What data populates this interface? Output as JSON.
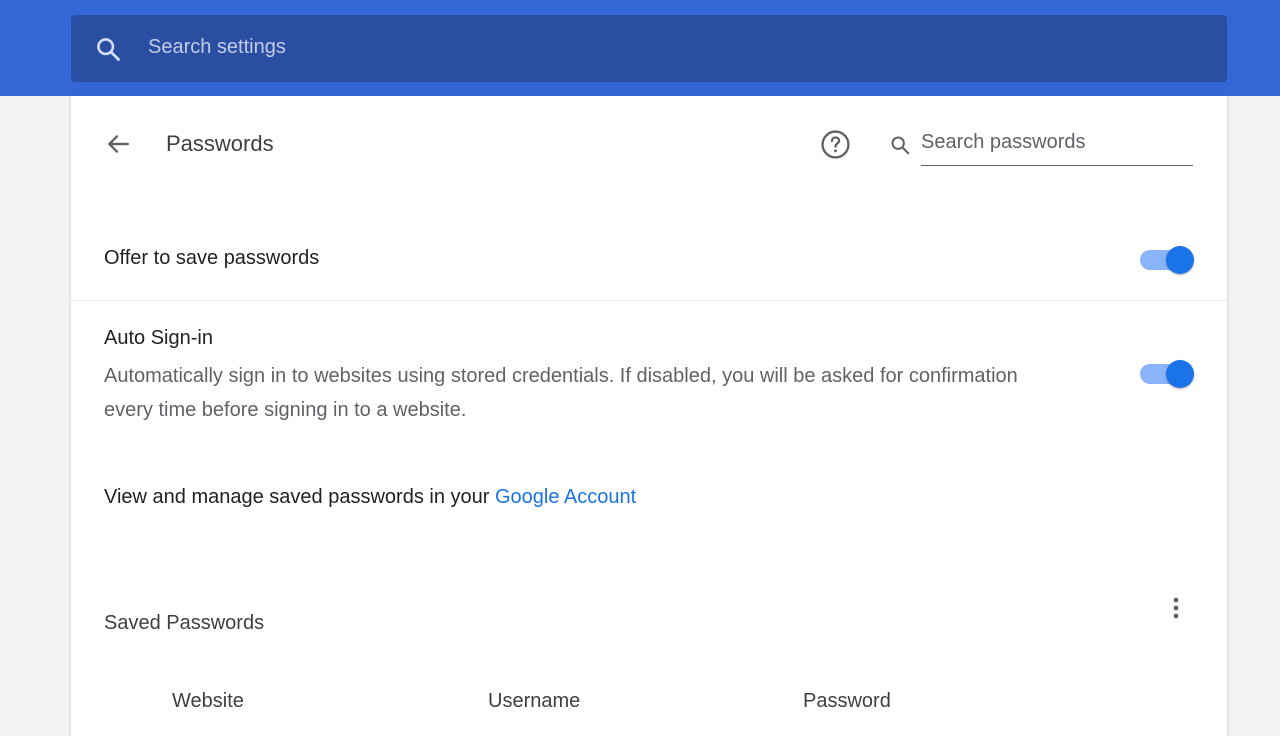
{
  "header": {
    "search_placeholder": "Search settings",
    "search_icon": "search-icon"
  },
  "passwords_page": {
    "title": "Passwords",
    "back_icon": "arrow-left-icon",
    "help_icon": "help-circle-icon",
    "search_placeholder": "Search passwords",
    "search_value": ""
  },
  "settings": {
    "offer_to_save": {
      "label": "Offer to save passwords",
      "enabled": true
    },
    "auto_signin": {
      "label": "Auto Sign-in",
      "description": "Automatically sign in to websites using stored credentials. If disabled, you will be asked for confirmation every time before signing in to a website.",
      "enabled": true
    }
  },
  "manage": {
    "text": "View and manage saved passwords in your ",
    "link_label": "Google Account"
  },
  "saved_passwords": {
    "title": "Saved Passwords",
    "more_icon": "more-vertical-icon",
    "columns": [
      "Website",
      "Username",
      "Password"
    ]
  },
  "colors": {
    "header_bg": "#3367d6",
    "search_bg": "#2a4ea2",
    "accent": "#1a73e8",
    "toggle_track": "#8ab4f8"
  }
}
